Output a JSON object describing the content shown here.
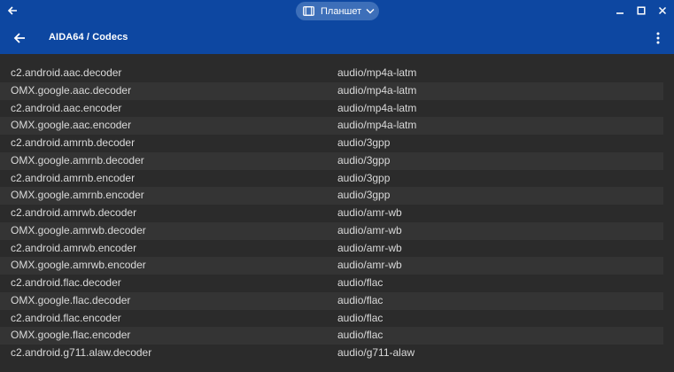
{
  "window": {
    "mode_label": "Планшет"
  },
  "appbar": {
    "title": "AIDA64  /  Codecs"
  },
  "codecs": [
    {
      "name": "c2.android.aac.decoder",
      "mime": "audio/mp4a-latm"
    },
    {
      "name": "OMX.google.aac.decoder",
      "mime": "audio/mp4a-latm"
    },
    {
      "name": "c2.android.aac.encoder",
      "mime": "audio/mp4a-latm"
    },
    {
      "name": "OMX.google.aac.encoder",
      "mime": "audio/mp4a-latm"
    },
    {
      "name": "c2.android.amrnb.decoder",
      "mime": "audio/3gpp"
    },
    {
      "name": "OMX.google.amrnb.decoder",
      "mime": "audio/3gpp"
    },
    {
      "name": "c2.android.amrnb.encoder",
      "mime": "audio/3gpp"
    },
    {
      "name": "OMX.google.amrnb.encoder",
      "mime": "audio/3gpp"
    },
    {
      "name": "c2.android.amrwb.decoder",
      "mime": "audio/amr-wb"
    },
    {
      "name": "OMX.google.amrwb.decoder",
      "mime": "audio/amr-wb"
    },
    {
      "name": "c2.android.amrwb.encoder",
      "mime": "audio/amr-wb"
    },
    {
      "name": "OMX.google.amrwb.encoder",
      "mime": "audio/amr-wb"
    },
    {
      "name": "c2.android.flac.decoder",
      "mime": "audio/flac"
    },
    {
      "name": "OMX.google.flac.decoder",
      "mime": "audio/flac"
    },
    {
      "name": "c2.android.flac.encoder",
      "mime": "audio/flac"
    },
    {
      "name": "OMX.google.flac.encoder",
      "mime": "audio/flac"
    },
    {
      "name": "c2.android.g711.alaw.decoder",
      "mime": "audio/g711-alaw"
    }
  ],
  "colors": {
    "bar": "#0d47a1",
    "background": "#2b2b2b",
    "row_alt": "#343434",
    "text": "#d9d9d9"
  },
  "icons": {
    "window_back": "arrow-left-icon",
    "mode": "tablet-icon",
    "mode_dropdown": "chevron-down-icon",
    "minimize": "minimize-icon",
    "maximize": "maximize-icon",
    "close": "close-icon",
    "app_back": "arrow-left-icon",
    "overflow": "more-vert-icon"
  }
}
